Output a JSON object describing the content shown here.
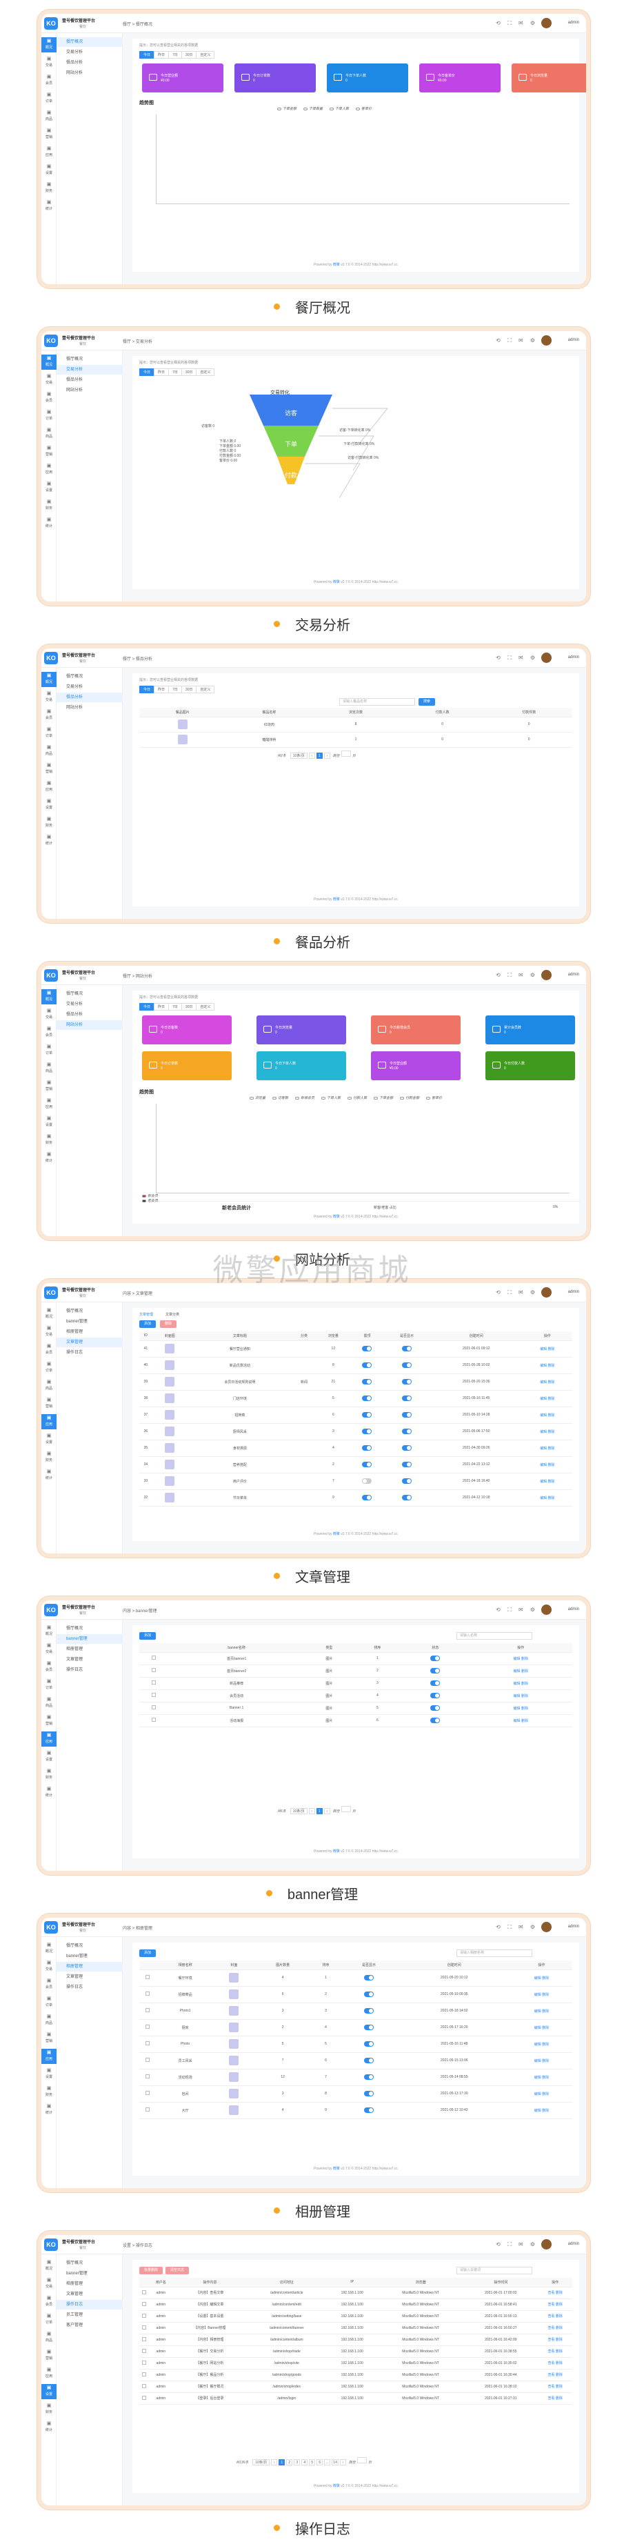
{
  "app": {
    "name": "壹号餐饮管理平台",
    "sub": "餐饮",
    "logo": "KO",
    "user": "admin",
    "tb_icons": "⟲ ⛶ ✉ ⚙"
  },
  "sidebar1": [
    "概况",
    "交易",
    "会员",
    "订单",
    "商品",
    "营销",
    "应用",
    "设置",
    "财务",
    "统计"
  ],
  "watermark": "微擎应用商城",
  "footer": {
    "prefix": "Powered by",
    "link": "微擎",
    "suffix": "v2.7.6 © 2014-2022 http://www.w7.cc"
  },
  "tip": "提示：您可以查看营业相关的各项数据",
  "tabs": [
    "今日",
    "昨日",
    "7日",
    "30日",
    "自定义"
  ],
  "sections": [
    {
      "caption": "餐厅概况",
      "bread": "餐厅 > 餐厅概况",
      "menu": [
        "餐厅概况",
        "交易分析",
        "餐品分析",
        "网站分析"
      ],
      "active": 0,
      "tiles": [
        {
          "label": "今日营业额",
          "value": "¥0.00",
          "color": "#b14ce8"
        },
        {
          "label": "今日订单数",
          "value": "0",
          "color": "#7f4de8"
        },
        {
          "label": "今日下单人数",
          "value": "0",
          "color": "#1e88e5"
        },
        {
          "label": "今日客单价",
          "value": "¥0.00",
          "color": "#c044e6"
        },
        {
          "label": "今日浏览量",
          "value": "0",
          "color": "#ee7466"
        }
      ],
      "chart_title": "趋势图",
      "legend": [
        "下单金额",
        "下单数量",
        "下单人数",
        "客单价"
      ]
    },
    {
      "caption": "交易分析",
      "bread": "餐厅 > 交易分析",
      "menu": [
        "餐厅概况",
        "交易分析",
        "餐品分析",
        "网站分析"
      ],
      "active": 1,
      "funnel": {
        "title": "交易转化",
        "levels": [
          {
            "label": "访客",
            "color": "#3b7ded"
          },
          {
            "label": "下单",
            "color": "#7bd34b"
          },
          {
            "label": "付款",
            "color": "#f5c228"
          }
        ],
        "left": [
          "访客数 0",
          "下单人数 0",
          "下单金额 0.00",
          "付款人数 0",
          "付款金额 0.00",
          "客单价 0.00"
        ],
        "right": [
          "访客-下单转化率 0%",
          "下单-付款转化率 0%",
          "访客-付款转化率 0%"
        ]
      }
    },
    {
      "caption": "餐品分析",
      "bread": "餐厅 > 餐品分析",
      "menu": [
        "餐厅概况",
        "交易分析",
        "餐品分析",
        "网站分析"
      ],
      "active": 2,
      "search": "请输入餐品名称",
      "search_btn": "搜索",
      "table": {
        "headers": [
          "餐品图片",
          "餐品名称",
          "浏览次数",
          "付款人数",
          "付款件数"
        ],
        "rows": [
          [
            "",
            "红烧肉",
            "8",
            "0",
            "0"
          ],
          [
            "",
            "糖醋排骨",
            "1",
            "0",
            "0"
          ]
        ]
      },
      "pager": {
        "total": "共2条",
        "size": "10条/页",
        "pages": [
          "1"
        ],
        "goto": "跳至",
        "page_unit": "页"
      }
    },
    {
      "caption": "网站分析",
      "bread": "餐厅 > 网站分析",
      "menu": [
        "餐厅概况",
        "交易分析",
        "餐品分析",
        "网站分析"
      ],
      "active": 3,
      "tiles": [
        {
          "label": "今日访客数",
          "value": "0",
          "color": "#d54be0"
        },
        {
          "label": "今日浏览量",
          "value": "0",
          "color": "#7b55e6"
        },
        {
          "label": "今日新增会员",
          "value": "0",
          "color": "#ee7466"
        },
        {
          "label": "累计会员数",
          "value": "0",
          "color": "#1e88e5"
        },
        {
          "label": "今日订单数",
          "value": "0",
          "color": "#f5a623"
        },
        {
          "label": "今日下单人数",
          "value": "0",
          "color": "#26b6d5"
        },
        {
          "label": "今日营业额",
          "value": "¥0.00",
          "color": "#b44ae6"
        },
        {
          "label": "今日付款人数",
          "value": "0",
          "color": "#3f9a1e"
        }
      ],
      "chart_title": "趋势图",
      "legend": [
        "浏览量",
        "访客数",
        "新增会员",
        "下单人数",
        "付款人数",
        "下单金额",
        "付款金额",
        "客单价"
      ],
      "sub": {
        "title": "新老会员统计",
        "right_label": "新客/老客 占比",
        "right_value": "0%",
        "legend": [
          "新会员",
          "老会员"
        ]
      }
    },
    {
      "caption": "文章管理",
      "bread": "内容 > 文章管理",
      "menu": [
        "餐厅概况",
        "banner管理",
        "相册管理",
        "文章管理",
        "操作日志"
      ],
      "active": 3,
      "subtabs": [
        "文章管理",
        "文章分类"
      ],
      "btns": [
        "添加",
        "删除"
      ],
      "table": {
        "headers": [
          "ID",
          "封面图",
          "文章标题",
          "分类",
          "浏览量",
          "置顶",
          "是否显示",
          "创建时间",
          "操作"
        ],
        "rows": [
          [
            "41",
            "",
            "餐厅营业通知",
            "",
            "12",
            "on",
            "on",
            "2021-06-01 09:12",
            "编辑 删除"
          ],
          [
            "40",
            "",
            "新品优惠活动",
            "",
            "8",
            "on",
            "on",
            "2021-05-28 10:02",
            "编辑 删除"
          ],
          [
            "39",
            "",
            "会员日活动规则说明",
            "新闻",
            "21",
            "on",
            "on",
            "2021-05-20 15:36",
            "编辑 删除"
          ],
          [
            "38",
            "",
            "门店环境",
            "",
            "5",
            "on",
            "on",
            "2021-05-16 11:45",
            "编辑 删除"
          ],
          [
            "37",
            "",
            "招牌菜",
            "",
            "6",
            "on",
            "on",
            "2021-05-10 14:28",
            "编辑 删除"
          ],
          [
            "36",
            "",
            "厨师风采",
            "",
            "3",
            "on",
            "on",
            "2021-05-06 17:50",
            "编辑 删除"
          ],
          [
            "35",
            "",
            "食材溯源",
            "",
            "4",
            "on",
            "on",
            "2021-04-30 09:26",
            "编辑 删除"
          ],
          [
            "34",
            "",
            "营养搭配",
            "",
            "2",
            "on",
            "on",
            "2021-04-22 13:12",
            "编辑 删除"
          ],
          [
            "33",
            "",
            "用户评价",
            "",
            "7",
            "off",
            "on",
            "2021-04-18 16:40",
            "编辑 删除"
          ],
          [
            "32",
            "",
            "节日菜单",
            "",
            "9",
            "on",
            "on",
            "2021-04-12 10:18",
            "编辑 删除"
          ]
        ]
      }
    },
    {
      "caption": "banner管理",
      "bread": "内容 > banner管理",
      "menu": [
        "餐厅概况",
        "banner管理",
        "相册管理",
        "文章管理",
        "操作日志"
      ],
      "active": 1,
      "btns": [
        "添加"
      ],
      "search": "请输入名称",
      "table": {
        "headers": [
          "",
          "banner名称",
          "类型",
          "排序",
          "状态",
          "操作"
        ],
        "rows": [
          [
            "",
            "首页banner1",
            "图片",
            "1",
            "on",
            "编辑 删除"
          ],
          [
            "",
            "首页banner2",
            "图片",
            "2",
            "on",
            "编辑 删除"
          ],
          [
            "",
            "新品推荐",
            "图片",
            "3",
            "on",
            "编辑 删除"
          ],
          [
            "",
            "会员活动",
            "图片",
            "4",
            "on",
            "编辑 删除"
          ],
          [
            "",
            "Banner 1",
            "图片",
            "5",
            "on",
            "编辑 删除"
          ],
          [
            "",
            "活动海报",
            "图片",
            "6",
            "on",
            "编辑 删除"
          ]
        ]
      },
      "pager": {
        "total": "共6条",
        "size": "10条/页",
        "pages": [
          "1"
        ],
        "goto": "跳至",
        "page_unit": "页"
      }
    },
    {
      "caption": "相册管理",
      "bread": "内容 > 相册管理",
      "menu": [
        "餐厅概况",
        "banner管理",
        "相册管理",
        "文章管理",
        "操作日志"
      ],
      "active": 2,
      "btns": [
        "添加"
      ],
      "search": "请输入相册名称",
      "table": {
        "headers": [
          "",
          "相册名称",
          "封面",
          "图片数量",
          "排序",
          "是否显示",
          "创建时间",
          "操作"
        ],
        "rows": [
          [
            "",
            "餐厅环境",
            "",
            "4",
            "1",
            "on",
            "2021-05-20 10:12",
            "编辑 删除"
          ],
          [
            "",
            "招牌菜品",
            "",
            "6",
            "2",
            "on",
            "2021-05-19 09:35",
            "编辑 删除"
          ],
          [
            "",
            "Photo1",
            "",
            "3",
            "3",
            "on",
            "2021-05-18 14:02",
            "编辑 删除"
          ],
          [
            "",
            "厨房",
            "",
            "2",
            "4",
            "on",
            "2021-05-17 16:20",
            "编辑 删除"
          ],
          [
            "",
            "Photo",
            "",
            "5",
            "5",
            "on",
            "2021-05-16 11:48",
            "编辑 删除"
          ],
          [
            "",
            "员工风采",
            "",
            "7",
            "6",
            "on",
            "2021-05-15 13:06",
            "编辑 删除"
          ],
          [
            "",
            "活动现场",
            "",
            "12",
            "7",
            "on",
            "2021-05-14 08:55",
            "编辑 删除"
          ],
          [
            "",
            "包间",
            "",
            "3",
            "8",
            "on",
            "2021-05-13 17:30",
            "编辑 删除"
          ],
          [
            "",
            "大厅",
            "",
            "4",
            "9",
            "on",
            "2021-05-12 10:42",
            "编辑 删除"
          ]
        ]
      }
    },
    {
      "caption": "操作日志",
      "bread": "设置 > 操作日志",
      "menu": [
        "餐厅概况",
        "banner管理",
        "相册管理",
        "文章管理",
        "操作日志",
        "员工管理",
        "客户管理"
      ],
      "active": 4,
      "btns": [
        "批量删除",
        "清空日志"
      ],
      "search": "请输入关键词",
      "table": {
        "headers": [
          "",
          "用户名",
          "操作内容",
          "访问地址",
          "IP",
          "浏览器",
          "操作时间",
          "操作"
        ],
        "rows": [
          [
            "",
            "admin",
            "【内容】查看文章",
            "/admin/content/article",
            "192.168.1.100",
            "Mozilla/5.0 Windows NT",
            "2021-06-01 17:00:02",
            "查看 删除"
          ],
          [
            "",
            "admin",
            "【内容】编辑文章",
            "/admin/content/edit",
            "192.168.1.100",
            "Mozilla/5.0 Windows NT",
            "2021-06-01 16:58:41",
            "查看 删除"
          ],
          [
            "",
            "admin",
            "【设置】基本设置",
            "/admin/setting/base",
            "192.168.1.100",
            "Mozilla/5.0 Windows NT",
            "2021-06-01 16:55:13",
            "查看 删除"
          ],
          [
            "",
            "admin",
            "【内容】Banner管理",
            "/admin/content/banner",
            "192.168.1.100",
            "Mozilla/5.0 Windows NT",
            "2021-06-01 16:50:27",
            "查看 删除"
          ],
          [
            "",
            "admin",
            "【内容】相册管理",
            "/admin/content/album",
            "192.168.1.100",
            "Mozilla/5.0 Windows NT",
            "2021-06-01 16:42:09",
            "查看 删除"
          ],
          [
            "",
            "admin",
            "【餐厅】交易分析",
            "/admin/shop/trade",
            "192.168.1.100",
            "Mozilla/5.0 Windows NT",
            "2021-06-01 16:38:55",
            "查看 删除"
          ],
          [
            "",
            "admin",
            "【餐厅】网站分析",
            "/admin/shop/site",
            "192.168.1.100",
            "Mozilla/5.0 Windows NT",
            "2021-06-01 16:35:02",
            "查看 删除"
          ],
          [
            "",
            "admin",
            "【餐厅】餐品分析",
            "/admin/shop/goods",
            "192.168.1.100",
            "Mozilla/5.0 Windows NT",
            "2021-06-01 16:30:44",
            "查看 删除"
          ],
          [
            "",
            "admin",
            "【餐厅】餐厅概况",
            "/admin/shop/index",
            "192.168.1.100",
            "Mozilla/5.0 Windows NT",
            "2021-06-01 16:28:10",
            "查看 删除"
          ],
          [
            "",
            "admin",
            "【登录】后台登录",
            "/admin/login",
            "192.168.1.100",
            "Mozilla/5.0 Windows NT",
            "2021-06-01 16:27:31",
            "查看 删除"
          ]
        ]
      },
      "pager": {
        "total": "共136条",
        "size": "10条/页",
        "pages": [
          "1",
          "2",
          "3",
          "4",
          "5",
          "6",
          "...",
          "14"
        ],
        "goto": "跳至",
        "page_unit": "页"
      }
    }
  ]
}
